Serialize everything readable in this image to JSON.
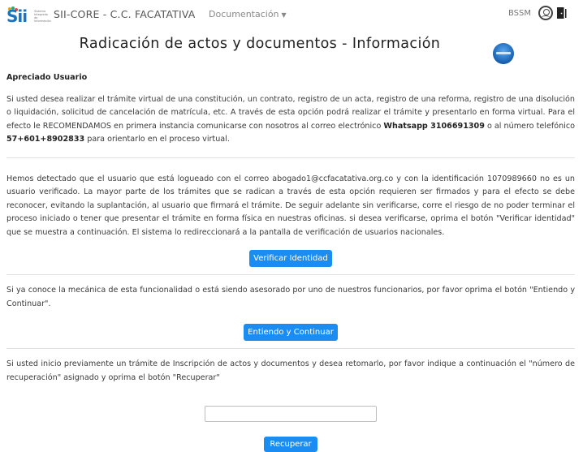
{
  "header": {
    "logo_text": "Sii",
    "logo_caption": "Sistema Integrado de Información",
    "app_title": "SII-CORE - C.C. FACATATIVA",
    "doc_menu_label": "Documentación",
    "user_initials": "BSSM",
    "icons": [
      "user-icon",
      "logout-door-icon"
    ]
  },
  "page": {
    "title": "Radicación de actos y documentos - Información"
  },
  "content": {
    "heading": "Apreciado Usuario",
    "para1_pre": "Si usted desea realizar el trámite virtual de una constitución, un contrato, registro de un acta, registro de una reforma, registro de una disolución o liquidación, solicitud de cancelación de matrícula, etc. A través de esta opción podrá realizar el trámite y presentarlo en forma virtual. Para el efecto le RECOMENDAMOS en primera instancia comunicarse con nosotros al correo electrónico ",
    "para1_whatsapp": "Whatsapp 3106691309",
    "para1_mid": " o al número telefónico ",
    "para1_phone": "57+601+8902833",
    "para1_post": " para orientarlo en el proceso virtual.",
    "para2": "Hemos detectado que el usuario que está logueado con el correo abogado1@ccfacatativa.org.co y con la identificación 1070989660 no es un usuario verificado. La mayor parte de los trámites que se radican a través de esta opción requieren ser firmados y para el efecto se debe reconocer, evitando la suplantación, al usuario que firmará el trámite. De seguir adelante sin verificarse, corre el riesgo de no poder terminar el proceso iniciado o tener que presentar el trámite en forma física en nuestras oficinas. si desea verificarse, oprima el botón \"Verificar identidad\" que se muestra a continuación. El sistema lo redireccionará a la pantalla de verificación de usuarios nacionales.",
    "verify_button": "Verificar Identidad",
    "para3": "Si ya conoce la mecánica de esta funcionalidad o está siendo asesorado por uno de nuestros funcionarios, por favor oprima el botón \"Entiendo y Continuar\".",
    "continue_button": "Entiendo y Continuar",
    "para4": "Si usted inicio previamente un trámite de Inscripción de actos y documentos y desea retomarlo, por favor indique a continuación el \"número de recuperación\" asignado y oprima el botón \"Recuperar\"",
    "recovery_input_value": "",
    "recover_button": "Recuperar"
  },
  "colors": {
    "primary_button": "#1b8df2",
    "logo_blue": "#1e73be"
  }
}
